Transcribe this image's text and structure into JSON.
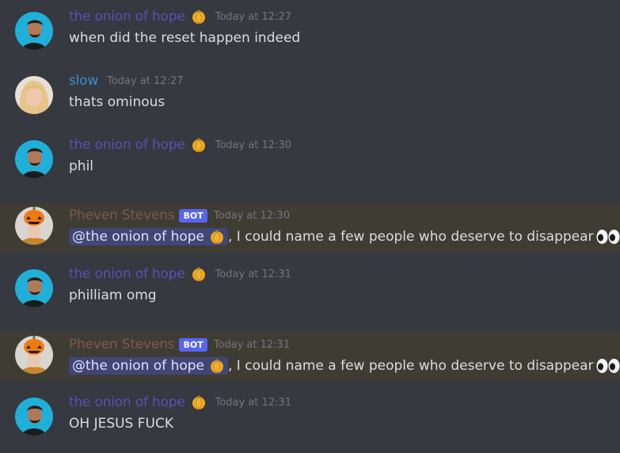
{
  "colors": {
    "onion_name": "#5a4fb6",
    "slow_name": "#3b8fd6",
    "pheven_name": "#7a5a4a",
    "background": "#36393f",
    "mention_background": "#3f3c34",
    "bot_tag": "#5865f2"
  },
  "messages": [
    {
      "author": "the onion of hope",
      "time": "Today at 12:27",
      "text": "when did the reset happen indeed",
      "avatar": "man-avatar",
      "emoji": "onion-icon"
    },
    {
      "author": "slow",
      "time": "Today at 12:27",
      "text": "thats ominous",
      "avatar": "girl-avatar"
    },
    {
      "author": "the onion of hope",
      "time": "Today at 12:30",
      "text": "phil",
      "avatar": "man-avatar",
      "emoji": "onion-icon"
    },
    {
      "author": "Pheven Stevens",
      "bot_label": "BOT",
      "time": "Today at 12:30",
      "mention": "@the onion of hope",
      "text": ", I could name a few people who deserve to disappear",
      "avatar": "pumpkin-avatar",
      "trailing_emoji": "eyes-icon"
    },
    {
      "author": "the onion of hope",
      "time": "Today at 12:31",
      "text": "philliam omg",
      "avatar": "man-avatar",
      "emoji": "onion-icon"
    },
    {
      "author": "Pheven Stevens",
      "bot_label": "BOT",
      "time": "Today at 12:31",
      "mention": "@the onion of hope",
      "text": ", I could name a few people who deserve to disappear",
      "avatar": "pumpkin-avatar",
      "trailing_emoji": "eyes-icon"
    },
    {
      "author": "the onion of hope",
      "time": "Today at 12:31",
      "text": "OH JESUS FUCK",
      "avatar": "man-avatar",
      "emoji": "onion-icon"
    }
  ]
}
